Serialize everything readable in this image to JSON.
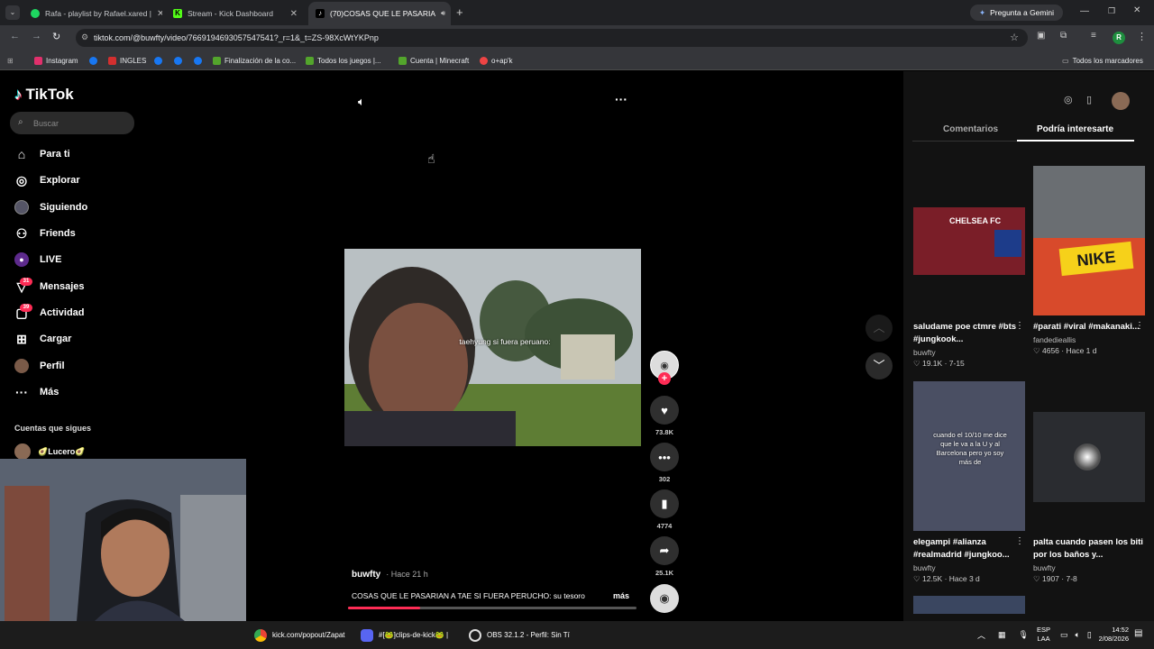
{
  "browser": {
    "tabs": [
      {
        "title": "Rafa - playlist by Rafael.xared |",
        "color": "#1ed760"
      },
      {
        "title": "Stream - Kick Dashboard",
        "color": "#53fc18"
      },
      {
        "title": "(70)COSAS QUE LE PASARIA",
        "color": "#000000"
      }
    ],
    "gemini": "Pregunta a Gemini",
    "url": "tiktok.com/@buwfty/video/7669194693057547541?_r=1&_t=ZS-98XcWtYKPnp",
    "profile_initial": "R",
    "bookmarks": [
      {
        "label": "Instagram",
        "color": "#e1306c"
      },
      {
        "label": "",
        "color": "#1877f2"
      },
      {
        "label": "INGLES",
        "color": "#d32f2f"
      },
      {
        "label": "",
        "color": "#1877f2"
      },
      {
        "label": "",
        "color": "#1877f2"
      },
      {
        "label": "",
        "color": "#1877f2"
      },
      {
        "label": "Finalización de la co...",
        "color": "#53a52c"
      },
      {
        "label": "Todos los juegos |...",
        "color": "#53a52c"
      },
      {
        "label": "Cuenta | Minecraft",
        "color": "#53a52c"
      },
      {
        "label": "o+ap'k",
        "color": "#e44"
      }
    ],
    "all_bookmarks": "Todos los marcadores"
  },
  "tiktok": {
    "logo": "TikTok",
    "search_placeholder": "Buscar",
    "nav": [
      {
        "label": "Para ti",
        "icon": "home-icon"
      },
      {
        "label": "Explorar",
        "icon": "compass-icon"
      },
      {
        "label": "Siguiendo",
        "icon": "following-icon"
      },
      {
        "label": "Friends",
        "icon": "friends-icon"
      },
      {
        "label": "LIVE",
        "icon": "live-icon"
      },
      {
        "label": "Mensajes",
        "icon": "message-icon",
        "badge": "31"
      },
      {
        "label": "Actividad",
        "icon": "activity-icon",
        "badge": "39"
      },
      {
        "label": "Cargar",
        "icon": "upload-icon"
      },
      {
        "label": "Perfil",
        "icon": "profile-icon"
      },
      {
        "label": "Más",
        "icon": "more-icon"
      }
    ],
    "following_header": "Cuentas que sigues",
    "following_user": "🥑Lucero🥑",
    "video": {
      "caption_overlay": "taehyung si fuera peruano:",
      "author": "buwfty",
      "posted": "· Hace 21 h",
      "description": "COSAS QUE LE PASARIAN A TAE SI FUERA PERUCHO: su tesoro",
      "more": "más",
      "likes": "73.8K",
      "comments": "302",
      "saves": "4774",
      "shares": "25.1K",
      "progress": 0.25
    },
    "right_tabs": [
      "Comentarios",
      "Podría interesarte"
    ],
    "cards": [
      {
        "title": "saludame poe ctmre #bts #jungkook...",
        "user": "buwfty",
        "likes": "19.1K",
        "date": "7-15",
        "thumb_text": "CHELSEA FC",
        "bg": "#7a1e28"
      },
      {
        "title": "#parati #viral #makanaki...",
        "user": "fandedieallis",
        "likes": "4656",
        "date": "Hace 1 d",
        "thumb_text": "NIKE",
        "bg": "#d84a2b"
      },
      {
        "title": "elegampi #alianza #realmadrid #jungkoo...",
        "user": "buwfty",
        "likes": "12.5K",
        "date": "Hace 3 d",
        "thumb_text": "cuando el 10/10 me dice que le va a la U y al Barcelona pero yo soy más de",
        "bg": "#4a4f63"
      },
      {
        "title": "palta cuando pasen los biti por los baños y...",
        "user": "buwfty",
        "likes": "1907",
        "date": "7-8",
        "thumb_text": "",
        "bg": "#2a2c30"
      }
    ]
  },
  "taskbar": {
    "items": [
      "kick.com/popout/Zapat",
      "#[🐸]clips-de-kick🐸 |",
      "OBS 32.1.2 - Perfil: Sin Tí"
    ],
    "lang": "ESP",
    "lang2": "LAA",
    "time": "14:52",
    "date": "2/08/2026"
  }
}
